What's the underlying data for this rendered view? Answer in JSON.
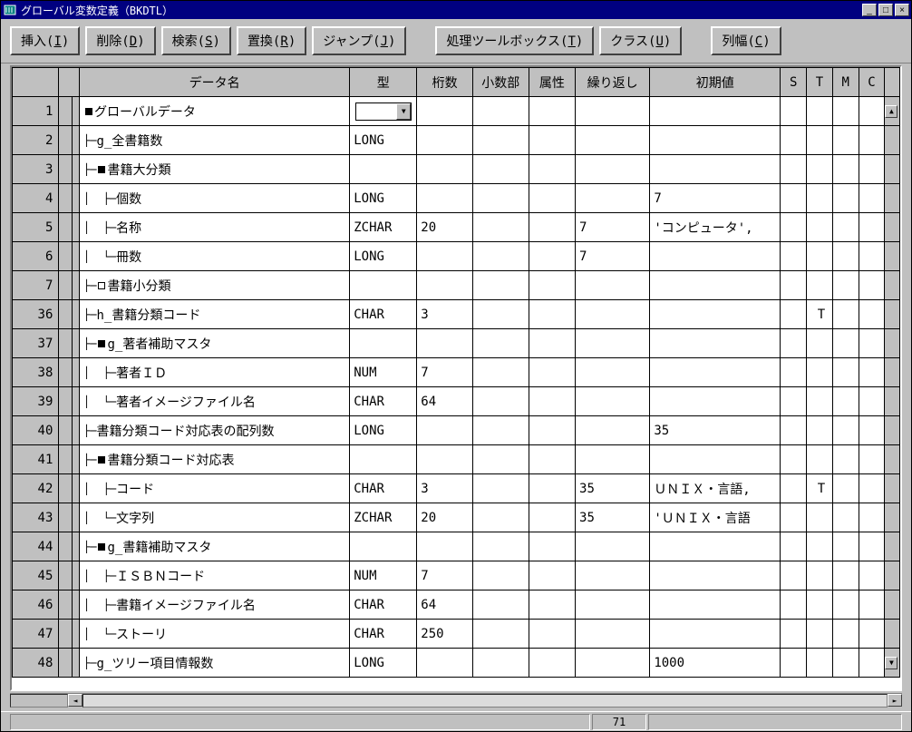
{
  "window": {
    "title": "グローバル変数定義（BKDTL）"
  },
  "toolbar": {
    "insert": "挿入(I)",
    "delete": "削除(D)",
    "search": "検索(S)",
    "replace": "置換(R)",
    "jump": "ジャンプ(J)",
    "toolbox": "処理ツールボックス(T)",
    "class": "クラス(U)",
    "colwidth": "列幅(C)"
  },
  "headers": {
    "name": "データ名",
    "type": "型",
    "digits": "桁数",
    "decimal": "小数部",
    "attr": "属性",
    "repeat": "繰り返し",
    "init": "初期値",
    "s": "S",
    "t": "T",
    "m": "M",
    "c": "C"
  },
  "rows": [
    {
      "n": "1",
      "indent": 0,
      "node": "filled",
      "name": "グローバルデータ",
      "type_select": true
    },
    {
      "n": "2",
      "indent": 1,
      "branch": "├",
      "name": "g_全書籍数",
      "type": "LONG"
    },
    {
      "n": "3",
      "indent": 1,
      "branch": "├",
      "node": "filled",
      "name": "書籍大分類"
    },
    {
      "n": "4",
      "indent": 2,
      "branch": "├",
      "name": "個数",
      "type": "LONG",
      "init": "7"
    },
    {
      "n": "5",
      "indent": 2,
      "branch": "├",
      "name": "名称",
      "type": "ZCHAR",
      "digits": "20",
      "repeat": "7",
      "init": "'コンピュータ',"
    },
    {
      "n": "6",
      "indent": 2,
      "branch": "└",
      "name": "冊数",
      "type": "LONG",
      "repeat": "7"
    },
    {
      "n": "7",
      "indent": 1,
      "branch": "├",
      "node": "open",
      "name": "書籍小分類"
    },
    {
      "n": "36",
      "indent": 1,
      "branch": "├",
      "name": "h_書籍分類コード",
      "type": "CHAR",
      "digits": "3",
      "t": "T"
    },
    {
      "n": "37",
      "indent": 1,
      "branch": "├",
      "node": "filled",
      "name": "g_著者補助マスタ"
    },
    {
      "n": "38",
      "indent": 2,
      "branch": "├",
      "name": "著者ＩＤ",
      "type": "NUM",
      "digits": "7"
    },
    {
      "n": "39",
      "indent": 2,
      "branch": "└",
      "name": "著者イメージファイル名",
      "type": "CHAR",
      "digits": "64"
    },
    {
      "n": "40",
      "indent": 1,
      "branch": "├",
      "name": "書籍分類コード対応表の配列数",
      "type": "LONG",
      "init": "35"
    },
    {
      "n": "41",
      "indent": 1,
      "branch": "├",
      "node": "filled",
      "name": "書籍分類コード対応表"
    },
    {
      "n": "42",
      "indent": 2,
      "branch": "├",
      "name": "コード",
      "type": "CHAR",
      "digits": "3",
      "repeat": "35",
      "init": "ＵＮＩＸ・言語,",
      "t": "T"
    },
    {
      "n": "43",
      "indent": 2,
      "branch": "└",
      "name": "文字列",
      "type": "ZCHAR",
      "digits": "20",
      "repeat": "35",
      "init": "'ＵＮＩＸ・言語"
    },
    {
      "n": "44",
      "indent": 1,
      "branch": "├",
      "node": "filled",
      "name": "g_書籍補助マスタ"
    },
    {
      "n": "45",
      "indent": 2,
      "branch": "├",
      "name": "ＩＳＢＮコード",
      "type": "NUM",
      "digits": "7"
    },
    {
      "n": "46",
      "indent": 2,
      "branch": "├",
      "name": "書籍イメージファイル名",
      "type": "CHAR",
      "digits": "64"
    },
    {
      "n": "47",
      "indent": 2,
      "branch": "└",
      "name": "ストーリ",
      "type": "CHAR",
      "digits": "250"
    },
    {
      "n": "48",
      "indent": 1,
      "branch": "├",
      "name": "g_ツリー項目情報数",
      "type": "LONG",
      "init": "1000"
    }
  ],
  "status": {
    "pos": "71"
  }
}
